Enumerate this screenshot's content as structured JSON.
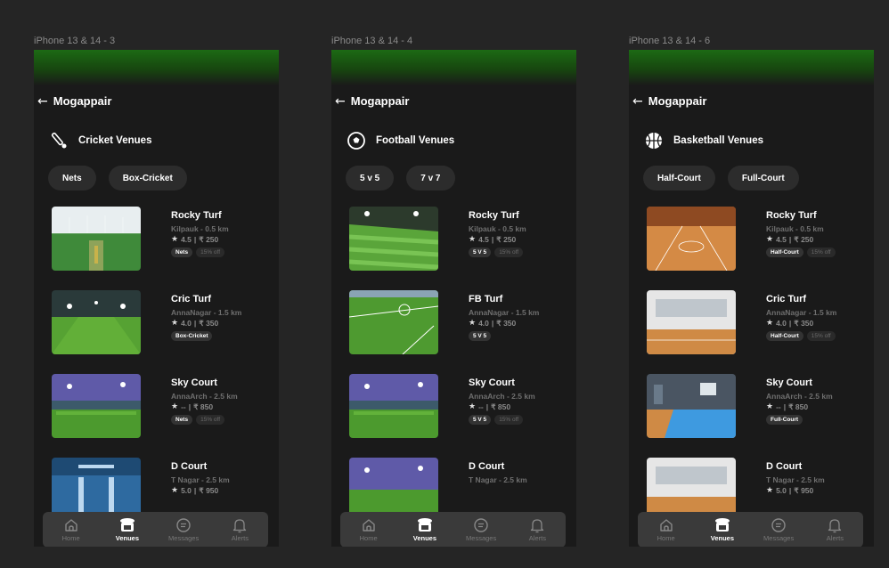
{
  "screens": [
    {
      "frame_label": "iPhone 13 & 14 - 3",
      "location": "Mogappair",
      "category": "Cricket Venues",
      "category_icon": "cricket-bat-icon",
      "filters": [
        "Nets",
        "Box-Cricket"
      ],
      "venues": [
        {
          "name": "Rocky Turf",
          "location": "Kilpauk - 0.5 km",
          "rating": "4.5",
          "price": "₹ 250",
          "tag": "Nets",
          "offer": "15% off"
        },
        {
          "name": "Cric Turf",
          "location": "AnnaNagar - 1.5 km",
          "rating": "4.0",
          "price": "₹ 350",
          "tag": "Box-Cricket",
          "offer": ""
        },
        {
          "name": "Sky Court",
          "location": "AnnaArch - 2.5 km",
          "rating": "--",
          "price": "₹ 850",
          "tag": "Nets",
          "offer": "15% off"
        },
        {
          "name": "D Court",
          "location": "T Nagar - 2.5 km",
          "rating": "5.0",
          "price": "₹ 950",
          "tag": "",
          "offer": ""
        }
      ]
    },
    {
      "frame_label": "iPhone 13 & 14 - 4",
      "location": "Mogappair",
      "category": "Football Venues",
      "category_icon": "football-icon",
      "filters": [
        "5 v 5",
        "7 v 7"
      ],
      "venues": [
        {
          "name": "Rocky Turf",
          "location": "Kilpauk - 0.5 km",
          "rating": "4.5",
          "price": "₹ 250",
          "tag": "5 V 5",
          "offer": "15% off"
        },
        {
          "name": "FB Turf",
          "location": "AnnaNagar - 1.5 km",
          "rating": "4.0",
          "price": "₹ 350",
          "tag": "5 V 5",
          "offer": ""
        },
        {
          "name": "Sky Court",
          "location": "AnnaArch - 2.5 km",
          "rating": "--",
          "price": "₹ 850",
          "tag": "5 V 5",
          "offer": "15% off"
        },
        {
          "name": "D Court",
          "location": "T Nagar - 2.5 km",
          "rating": "",
          "price": "",
          "tag": "",
          "offer": ""
        }
      ]
    },
    {
      "frame_label": "iPhone 13 & 14 - 6",
      "location": "Mogappair",
      "category": "Basketball Venues",
      "category_icon": "basketball-icon",
      "filters": [
        "Half-Court",
        "Full-Court"
      ],
      "venues": [
        {
          "name": "Rocky Turf",
          "location": "Kilpauk - 0.5 km",
          "rating": "4.5",
          "price": "₹ 250",
          "tag": "Half-Court",
          "offer": "15% off"
        },
        {
          "name": "Cric Turf",
          "location": "AnnaNagar - 1.5 km",
          "rating": "4.0",
          "price": "₹ 350",
          "tag": "Half-Court",
          "offer": "15% off"
        },
        {
          "name": "Sky Court",
          "location": "AnnaArch - 2.5 km",
          "rating": "--",
          "price": "₹ 850",
          "tag": "Full-Court",
          "offer": ""
        },
        {
          "name": "D Court",
          "location": "T Nagar - 2.5 km",
          "rating": "5.0",
          "price": "₹ 950",
          "tag": "",
          "offer": ""
        }
      ]
    }
  ],
  "tabbar": [
    {
      "label": "Home",
      "icon": "home-icon"
    },
    {
      "label": "Venues",
      "icon": "venues-icon"
    },
    {
      "label": "Messages",
      "icon": "message-icon"
    },
    {
      "label": "Alerts",
      "icon": "bell-icon"
    }
  ],
  "colors": {
    "background": "#252525",
    "phone": "#1a1a1a",
    "top_gradient": "#1c6a14",
    "chip": "#2c2c2c",
    "tabbar": "#3a3a3a"
  }
}
